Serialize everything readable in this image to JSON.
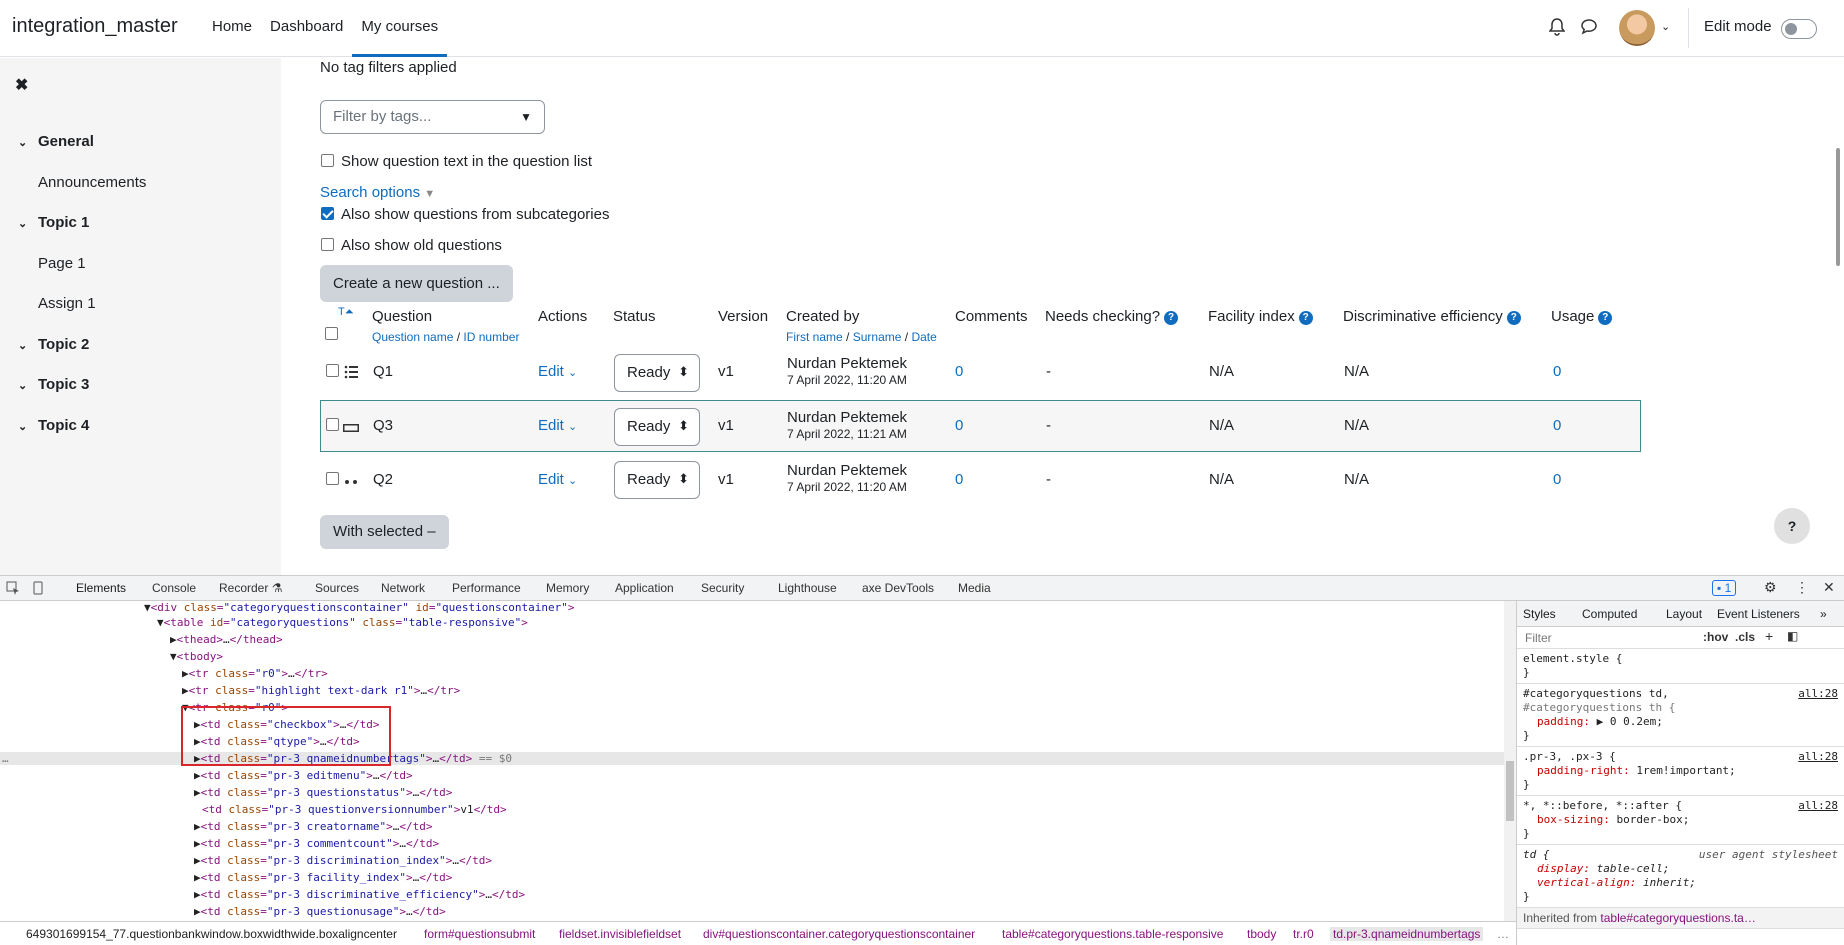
{
  "navbar": {
    "brand": "integration_master",
    "items": [
      "Home",
      "Dashboard",
      "My courses"
    ],
    "edit_mode_label": "Edit mode"
  },
  "sidebar": {
    "sections": [
      "General",
      "Topic 1",
      "Topic 2",
      "Topic 3",
      "Topic 4"
    ],
    "subitems": [
      "Announcements",
      "Page 1",
      "Assign 1"
    ]
  },
  "main": {
    "no_tag_filters": "No tag filters applied",
    "filter_placeholder": "Filter by tags...",
    "show_question_text": "Show question text in the question list",
    "search_options": "Search options",
    "also_subcategories": "Also show questions from subcategories",
    "also_old": "Also show old questions",
    "create_button": "Create a new question ...",
    "with_selected": "With selected",
    "table": {
      "sort_t": "T",
      "headers": {
        "question": "Question",
        "question_sub_a": "Question name",
        "question_sub_sep": "/",
        "question_sub_b": "ID number",
        "actions": "Actions",
        "status": "Status",
        "version": "Version",
        "created_by": "Created by",
        "created_sub_a": "First name",
        "created_sub_b": "Surname",
        "created_sub_c": "Date",
        "comments": "Comments",
        "needs_checking": "Needs checking?",
        "facility": "Facility index",
        "discriminative": "Discriminative efficiency",
        "usage": "Usage"
      },
      "rows": [
        {
          "name": "Q1",
          "action": "Edit",
          "status": "Ready",
          "version": "v1",
          "creator": "Nurdan Pektemek",
          "date": "7 April 2022, 11:20 AM",
          "comments": "0",
          "needs": "-",
          "facility": "N/A",
          "disc": "N/A",
          "usage": "0"
        },
        {
          "name": "Q3",
          "action": "Edit",
          "status": "Ready",
          "version": "v1",
          "creator": "Nurdan Pektemek",
          "date": "7 April 2022, 11:21 AM",
          "comments": "0",
          "needs": "-",
          "facility": "N/A",
          "disc": "N/A",
          "usage": "0"
        },
        {
          "name": "Q2",
          "action": "Edit",
          "status": "Ready",
          "version": "v1",
          "creator": "Nurdan Pektemek",
          "date": "7 April 2022, 11:20 AM",
          "comments": "0",
          "needs": "-",
          "facility": "N/A",
          "disc": "N/A",
          "usage": "0"
        }
      ]
    },
    "help_button": "?"
  },
  "devtools": {
    "tabs": [
      "Elements",
      "Console",
      "Recorder",
      "Sources",
      "Network",
      "Performance",
      "Memory",
      "Application",
      "Security",
      "Lighthouse",
      "axe DevTools",
      "Media"
    ],
    "issues_count": "1",
    "dom_lines": [
      "▼<div class=\"categoryquestionscontainer\" id=\"questionscontainer\">",
      "▼<table id=\"categoryquestions\" class=\"table-responsive\">",
      "▶<thead>…</thead>",
      "▼<tbody>",
      "▶<tr class=\"r0\">…</tr>",
      "▶<tr class=\"highlight text-dark r1\">…</tr>",
      "▼<tr class=\"r0\">",
      "▶<td class=\"checkbox\">…</td>",
      "▶<td class=\"qtype\">…</td>",
      "▶<td class=\"pr-3 qnameidnumbertags\">…</td> == $0",
      "▶<td class=\"pr-3 editmenu\">…</td>",
      "▶<td class=\"pr-3 questionstatus\">…</td>",
      "<td class=\"pr-3 questionversionnumber\">v1</td>",
      "▶<td class=\"pr-3 creatorname\">…</td>",
      "▶<td class=\"pr-3 commentcount\">…</td>",
      "▶<td class=\"pr-3 discrimination_index\">…</td>",
      "▶<td class=\"pr-3 facility_index\">…</td>",
      "▶<td class=\"pr-3 discriminative_efficiency\">…</td>",
      "▶<td class=\"pr-3 questionusage\">…</td>"
    ],
    "styles_tabs": [
      "Styles",
      "Computed",
      "Layout",
      "Event Listeners"
    ],
    "styles_filter": "Filter",
    "styles_hov": ":hov",
    "styles_cls": ".cls",
    "rules": [
      {
        "selector": "element.style {",
        "source": "",
        "props": [],
        "close": "}"
      },
      {
        "selector": "#categoryquestions td,",
        "selector2": "#categoryquestions th {",
        "source": "all:28",
        "props": [
          [
            "padding",
            "▶ 0 0.2em;"
          ]
        ],
        "close": "}"
      },
      {
        "selector": ".pr-3, .px-3 {",
        "source": "all:28",
        "props": [
          [
            "padding-right",
            "1rem!important;"
          ]
        ],
        "close": "}"
      },
      {
        "selector": "*, *::before, *::after {",
        "source": "all:28",
        "props": [
          [
            "box-sizing",
            "border-box;"
          ]
        ],
        "close": "}"
      },
      {
        "selector": "td {",
        "source": "user agent stylesheet",
        "props": [
          [
            "display",
            "table-cell;"
          ],
          [
            "vertical-align",
            "inherit;"
          ]
        ],
        "close": "}"
      }
    ],
    "inherited_from": "Inherited from",
    "inherited_target": "table#categoryquestions.ta…",
    "breadcrumb": [
      "649301699154_77.questionbankwindow.boxwidthwide.boxaligncenter",
      "form#questionsubmit",
      "fieldset.invisiblefieldset",
      "div#questionscontainer.categoryquestionscontainer",
      "table#categoryquestions.table-responsive",
      "tbody",
      "tr.r0",
      "td.pr-3.qnameidnumbertags"
    ]
  }
}
